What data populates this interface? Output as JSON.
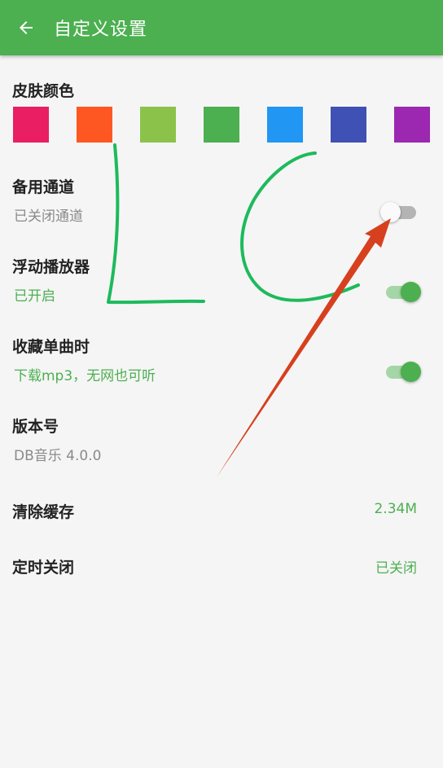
{
  "appbar": {
    "title": "自定义设置",
    "back_icon": "arrow-left-icon",
    "background_color": "#4caf50"
  },
  "skin": {
    "title": "皮肤颜色",
    "colors": [
      "#e91e63",
      "#ff5722",
      "#8bc34a",
      "#4caf50",
      "#2196f3",
      "#3f51b5",
      "#9c27b0"
    ]
  },
  "backup_channel": {
    "title": "备用通道",
    "status": "已关闭通道",
    "enabled": false
  },
  "floating_player": {
    "title": "浮动播放器",
    "status": "已开启",
    "enabled": true
  },
  "favorite_song": {
    "title": "收藏单曲时",
    "status": "下载mp3，无网也可听",
    "enabled": true
  },
  "version": {
    "title": "版本号",
    "value": "DB音乐 4.0.0"
  },
  "clear_cache": {
    "title": "清除缓存",
    "value": "2.34M"
  },
  "timer_close": {
    "title": "定时关闭",
    "value": "已关闭"
  },
  "colors": {
    "accent": "#4caf50",
    "annotation_green": "#1dba5c",
    "annotation_arrow": "#d7401e"
  }
}
